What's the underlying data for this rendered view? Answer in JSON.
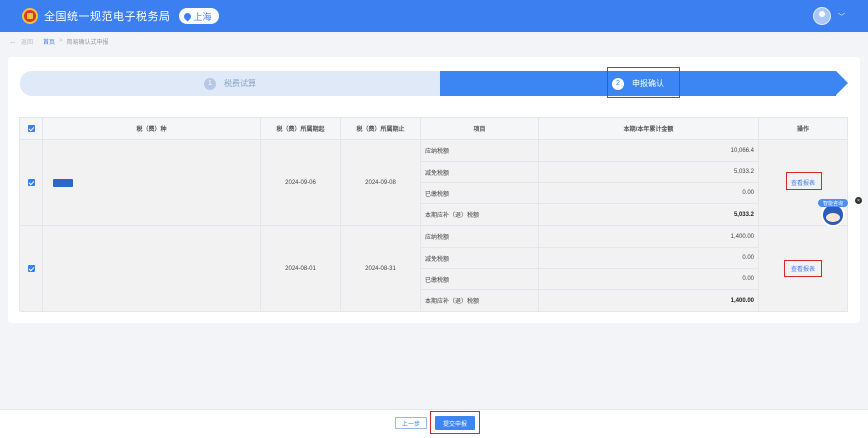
{
  "header": {
    "app_title": "全国统一规范电子税务局",
    "region": "上海"
  },
  "breadcrumb": {
    "back": "返回",
    "home": "首页",
    "separator": ">",
    "current": "简易确认式申报"
  },
  "steps": [
    {
      "num": "1",
      "label": "税费试算",
      "state": "done"
    },
    {
      "num": "2",
      "label": "申报确认",
      "state": "active"
    }
  ],
  "table": {
    "headers": {
      "tax": "税（费）种",
      "start": "税（费）所属期起",
      "end": "税（费）所属期止",
      "item": "项目",
      "amount": "本期/本年累计金额",
      "action": "操作"
    },
    "rows": [
      {
        "start": "2024-09-06",
        "end": "2024-09-08",
        "items": [
          {
            "label": "应纳税额",
            "value": "10,066.4"
          },
          {
            "label": "减免税额",
            "value": "5,033.2"
          },
          {
            "label": "已缴税额",
            "value": "0.00"
          },
          {
            "label": "本期应补（退）税额",
            "value": "5,033.2"
          }
        ],
        "action": "查看报表"
      },
      {
        "start": "2024-08-01",
        "end": "2024-08-31",
        "items": [
          {
            "label": "应纳税额",
            "value": "1,400.00"
          },
          {
            "label": "减免税额",
            "value": "0.00"
          },
          {
            "label": "已缴税额",
            "value": "0.00"
          },
          {
            "label": "本期应补（退）税额",
            "value": "1,400.00"
          }
        ],
        "action": "查看报表"
      }
    ]
  },
  "mascot": {
    "tag": "智能咨询"
  },
  "footer": {
    "prev": "上一步",
    "submit": "提交申报"
  },
  "colors": {
    "brand": "#3b7ff0",
    "highlight": "#d9262a"
  }
}
